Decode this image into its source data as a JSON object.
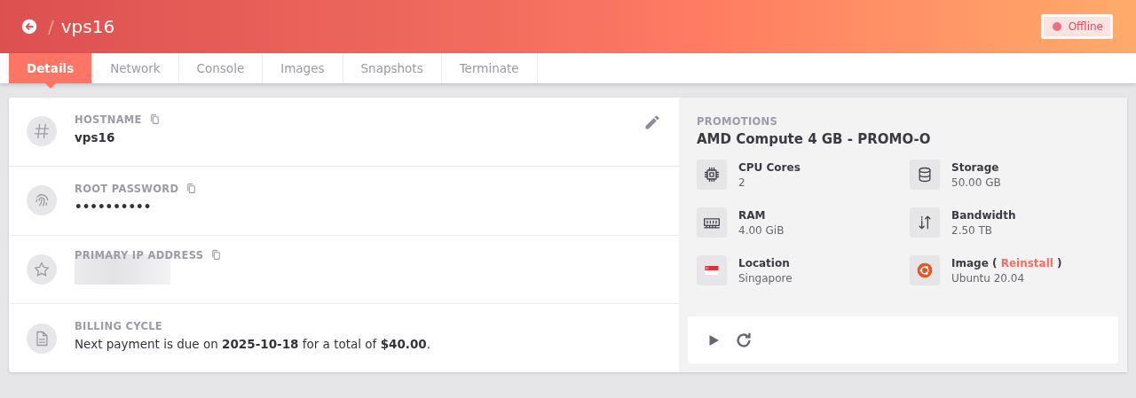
{
  "header": {
    "back_button": true,
    "separator": "/",
    "title": "vps16",
    "status": {
      "label": "Offline",
      "color": "#f0707a"
    }
  },
  "tabs": [
    {
      "label": "Details",
      "selected": true
    },
    {
      "label": "Network",
      "selected": false
    },
    {
      "label": "Console",
      "selected": false
    },
    {
      "label": "Images",
      "selected": false
    },
    {
      "label": "Snapshots",
      "selected": false
    },
    {
      "label": "Terminate",
      "selected": false
    }
  ],
  "details": [
    {
      "kind": "hash",
      "label": "HOSTNAME",
      "copyable": true,
      "editable": true,
      "value": "vps16"
    },
    {
      "kind": "fingerprint",
      "label": "ROOT PASSWORD",
      "copyable": true,
      "editable": false,
      "value": "••••••••••"
    },
    {
      "kind": "star",
      "label": "PRIMARY IP ADDRESS",
      "copyable": true,
      "editable": false
    },
    {
      "kind": "document",
      "label": "BILLING CYCLE",
      "copyable": false,
      "editable": false,
      "value": "Next payment is due on **2025-10-18** for a total of **$40.00**."
    }
  ],
  "plan": {
    "label": "PROMOTIONS",
    "name": "AMD Compute 4 GB - PROMO-O",
    "specs": [
      {
        "kind": "cpu",
        "label": "CPU Cores",
        "value": "2"
      },
      {
        "kind": "storage",
        "label": "Storage",
        "value": "50.00 GB"
      },
      {
        "kind": "ram",
        "label": "RAM",
        "value": "4.00 GiB"
      },
      {
        "kind": "bandwidth",
        "label": "Bandwidth",
        "value": "2.50 TB"
      },
      {
        "kind": "flag",
        "label": "Location",
        "value": "Singapore"
      },
      {
        "kind": "os",
        "label": "Image (",
        "link": "Reinstall",
        "label_end": ")",
        "value": "Ubuntu 20.04"
      }
    ],
    "actions": [
      {
        "kind": "start"
      },
      {
        "kind": "restart"
      }
    ]
  }
}
